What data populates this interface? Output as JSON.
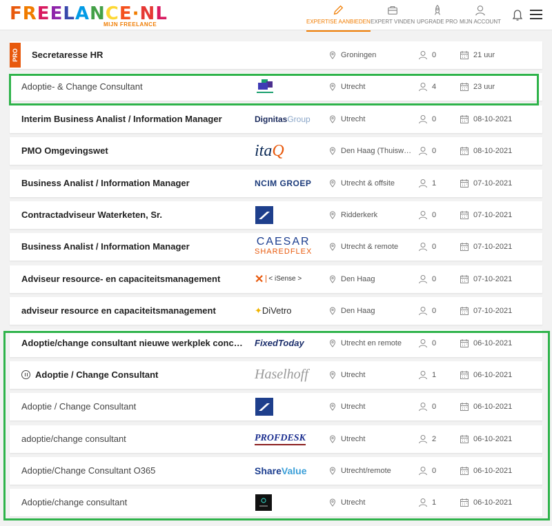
{
  "header": {
    "logo_main": "FREELANCE·NL",
    "logo_sub": "MIJN FREELANCE",
    "nav": [
      {
        "label": "EXPERTISE AANBIEDEN",
        "icon": "pencil-icon",
        "active": true
      },
      {
        "label": "EXPERT VINDEN",
        "icon": "briefcase-icon",
        "active": false
      },
      {
        "label": "UPGRADE PRO",
        "icon": "rocket-icon",
        "active": false
      },
      {
        "label": "MIJN ACCOUNT",
        "icon": "user-icon",
        "active": false
      }
    ]
  },
  "colors": {
    "accent": "#f07c00",
    "pro": "#e8590c",
    "highlight": "#2eb34a"
  },
  "rows": [
    {
      "title": "Secretaresse HR",
      "weight": "bold",
      "pro": "PRO",
      "logo": "",
      "location": "Groningen",
      "count": "0",
      "date": "21 uur"
    },
    {
      "title": "Adoptie- & Change Consultant",
      "weight": "normal",
      "logo": "logo-cube",
      "location": "Utrecht",
      "count": "4",
      "date": "23 uur"
    },
    {
      "title": "Interim Business Analist / Information Manager",
      "weight": "bold",
      "logo": "DignitasGroup",
      "location": "Utrecht",
      "count": "0",
      "date": "08-10-2021"
    },
    {
      "title": "PMO Omgevingswet",
      "weight": "bold",
      "logo": "itaQ",
      "location": "Den Haag (Thuisw…",
      "count": "0",
      "date": "08-10-2021"
    },
    {
      "title": "Business Analist / Information Manager",
      "weight": "bold",
      "logo": "NCIM GROEP",
      "location": "Utrecht & offsite",
      "count": "1",
      "date": "07-10-2021"
    },
    {
      "title": "Contractadviseur Waterketen, Sr.",
      "weight": "bold",
      "logo": "logo-blue-square",
      "location": "Ridderkerk",
      "count": "0",
      "date": "07-10-2021"
    },
    {
      "title": "Business Analist / Information Manager",
      "weight": "bold",
      "logo": "CAESAR SHAREDFLEX",
      "location": "Utrecht & remote",
      "count": "0",
      "date": "07-10-2021"
    },
    {
      "title": "Adviseur resource- en capaciteitsmanagement",
      "weight": "bold",
      "logo": "X Experts iSense",
      "location": "Den Haag",
      "count": "0",
      "date": "07-10-2021"
    },
    {
      "title": "adviseur resource en capaciteitsmanagement",
      "weight": "bold",
      "logo": "DiVetro",
      "location": "Den Haag",
      "count": "0",
      "date": "07-10-2021"
    },
    {
      "title": "Adoptie/change consultant nieuwe werkplek conc…",
      "weight": "bold",
      "logo": "FixedToday",
      "location": "Utrecht en remote",
      "count": "0",
      "date": "06-10-2021"
    },
    {
      "title": "Adoptie / Change Consultant",
      "weight": "bold",
      "paused": true,
      "logo": "Haselhoff",
      "location": "Utrecht",
      "count": "1",
      "date": "06-10-2021"
    },
    {
      "title": "Adoptie / Change Consultant",
      "weight": "normal",
      "logo": "logo-blue-square",
      "location": "Utrecht",
      "count": "0",
      "date": "06-10-2021"
    },
    {
      "title": "adoptie/change consultant",
      "weight": "normal",
      "logo": "PROFDESK",
      "location": "Utrecht",
      "count": "2",
      "date": "06-10-2021"
    },
    {
      "title": "Adoptie/Change Consultant O365",
      "weight": "normal",
      "logo": "ShareValue",
      "location": "Utrecht/remote",
      "count": "0",
      "date": "06-10-2021"
    },
    {
      "title": "Adoptie/change consultant",
      "weight": "normal",
      "logo": "logo-black-square",
      "location": "Utrecht",
      "count": "1",
      "date": "06-10-2021"
    }
  ]
}
